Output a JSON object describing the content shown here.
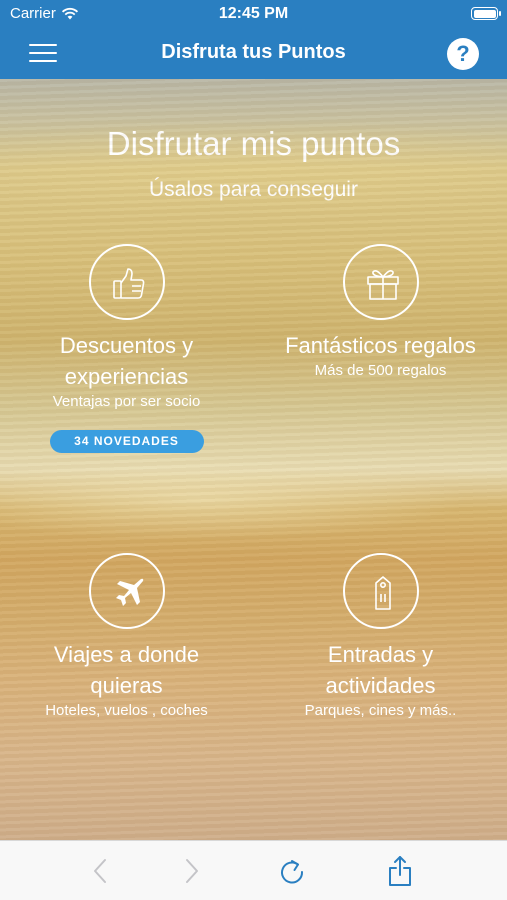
{
  "status_bar": {
    "carrier": "Carrier",
    "time": "12:45 PM"
  },
  "navbar": {
    "title": "Disfruta tus Puntos",
    "help_label": "?"
  },
  "hero": {
    "title": "Disfrutar mis puntos",
    "subtitle": "Úsalos para conseguir"
  },
  "tiles": [
    {
      "icon": "thumbs-up-icon",
      "title_line1": "Descuentos y",
      "title_line2": "experiencias",
      "description": "Ventajas por ser socio",
      "badge": "34 NOVEDADES"
    },
    {
      "icon": "gift-icon",
      "title_line1": "Fantásticos regalos",
      "description": "Más de 500 regalos"
    },
    {
      "icon": "airplane-icon",
      "title_line1": "Viajes a donde",
      "title_line2": "quieras",
      "description": "Hoteles, vuelos , coches"
    },
    {
      "icon": "ticket-icon",
      "title_line1": "Entradas y",
      "title_line2": "actividades",
      "description": "Parques, cines y más.."
    }
  ],
  "toolbar": {
    "icons": [
      "back-arrow-icon",
      "forward-arrow-icon",
      "reload-icon",
      "share-icon"
    ]
  },
  "colors": {
    "header": "#2a7fc1",
    "badge": "#3a9ee0",
    "toolbar_active": "#2a7fc1",
    "toolbar_disabled": "#c4c4c8"
  }
}
